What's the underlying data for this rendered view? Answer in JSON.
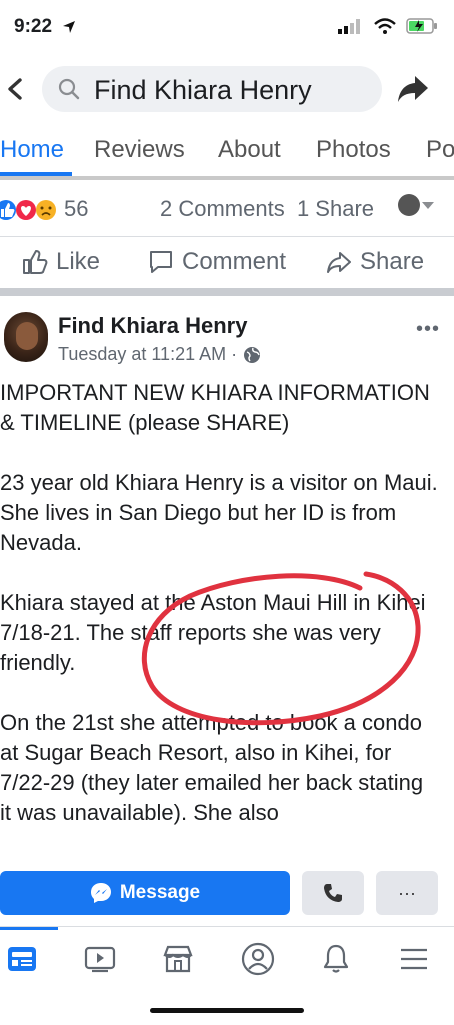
{
  "status_bar": {
    "time": "9:22"
  },
  "header": {
    "search_text": "Find Khiara Henry"
  },
  "tabs": [
    {
      "label": "Home"
    },
    {
      "label": "Reviews"
    },
    {
      "label": "About"
    },
    {
      "label": "Photos"
    },
    {
      "label": "Po"
    }
  ],
  "reactions": {
    "count": "56",
    "comments": "2 Comments",
    "shares": "1 Share"
  },
  "actions": {
    "like": "Like",
    "comment": "Comment",
    "share": "Share"
  },
  "post": {
    "author": "Find Khiara Henry",
    "time": "Tuesday at 11:21 AM ·",
    "paragraphs": [
      "IMPORTANT NEW KHIARA INFORMATION & TIMELINE (please SHARE)",
      "23 year old Khiara Henry is a visitor on Maui. She lives in San Diego but her ID is from Nevada.",
      "Khiara stayed at the Aston Maui Hill in Kihei 7/18-21. The staff reports she was very friendly.",
      "On the 21st she attempted to book a condo at Sugar Beach Resort, also in Kihei, for 7/22-29 (they later emailed her back stating it was unavailable). She also"
    ]
  },
  "buttons": {
    "message": "Message",
    "more": "···"
  },
  "colors": {
    "accent": "#1877f2",
    "annotation": "#e0323f"
  },
  "icons": [
    "search-icon",
    "back-chevron-icon",
    "share-arrow-icon",
    "like-thumb-icon",
    "comment-bubble-icon",
    "share-icon",
    "globe-icon",
    "messenger-icon",
    "phone-icon",
    "news-feed-icon",
    "watch-icon",
    "marketplace-icon",
    "profile-icon",
    "bell-icon",
    "menu-icon"
  ]
}
